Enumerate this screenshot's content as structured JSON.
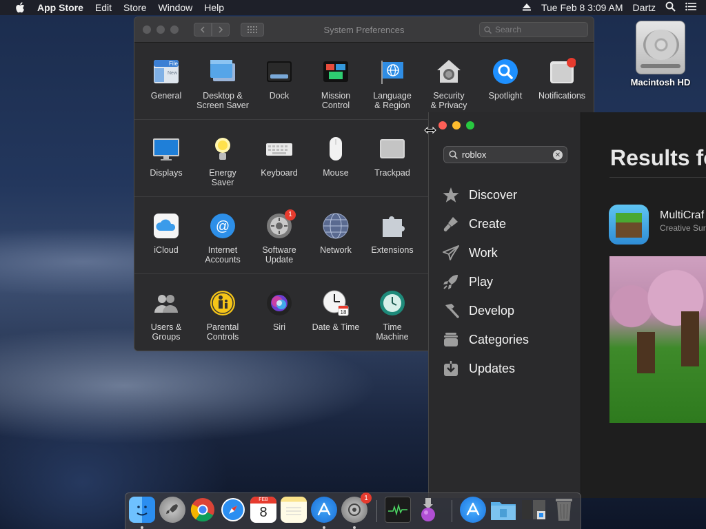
{
  "menubar": {
    "app_name": "App Store",
    "menus": [
      "Edit",
      "Store",
      "Window",
      "Help"
    ],
    "datetime": "Tue Feb 8  3:09 AM",
    "user": "Dartz"
  },
  "desktop": {
    "disk_label": "Macintosh HD"
  },
  "system_preferences": {
    "title": "System Preferences",
    "search_placeholder": "Search",
    "rows": [
      [
        {
          "label": "General",
          "icon": "general-icon"
        },
        {
          "label": "Desktop &\nScreen Saver",
          "icon": "desktop-screensaver-icon"
        },
        {
          "label": "Dock",
          "icon": "dock-icon"
        },
        {
          "label": "Mission\nControl",
          "icon": "mission-control-icon"
        },
        {
          "label": "Language\n& Region",
          "icon": "language-region-icon"
        },
        {
          "label": "Security\n& Privacy",
          "icon": "security-privacy-icon"
        },
        {
          "label": "Spotlight",
          "icon": "spotlight-icon"
        },
        {
          "label": "Notifications",
          "icon": "notifications-icon"
        }
      ],
      [
        {
          "label": "Displays",
          "icon": "displays-icon"
        },
        {
          "label": "Energy\nSaver",
          "icon": "energy-saver-icon"
        },
        {
          "label": "Keyboard",
          "icon": "keyboard-icon"
        },
        {
          "label": "Mouse",
          "icon": "mouse-icon"
        },
        {
          "label": "Trackpad",
          "icon": "trackpad-icon"
        }
      ],
      [
        {
          "label": "iCloud",
          "icon": "icloud-icon"
        },
        {
          "label": "Internet\nAccounts",
          "icon": "internet-accounts-icon"
        },
        {
          "label": "Software\nUpdate",
          "icon": "software-update-icon",
          "badge": "1"
        },
        {
          "label": "Network",
          "icon": "network-icon"
        },
        {
          "label": "Extensions",
          "icon": "extensions-icon"
        }
      ],
      [
        {
          "label": "Users &\nGroups",
          "icon": "users-groups-icon"
        },
        {
          "label": "Parental\nControls",
          "icon": "parental-controls-icon"
        },
        {
          "label": "Siri",
          "icon": "siri-icon"
        },
        {
          "label": "Date & Time",
          "icon": "date-time-icon"
        },
        {
          "label": "Time\nMachine",
          "icon": "time-machine-icon"
        }
      ]
    ]
  },
  "app_store": {
    "search_value": "roblox",
    "nav": [
      {
        "label": "Discover",
        "icon": "star-icon"
      },
      {
        "label": "Create",
        "icon": "brush-icon"
      },
      {
        "label": "Work",
        "icon": "paper-plane-icon"
      },
      {
        "label": "Play",
        "icon": "rocket-icon"
      },
      {
        "label": "Develop",
        "icon": "hammer-icon"
      },
      {
        "label": "Categories",
        "icon": "categories-icon"
      },
      {
        "label": "Updates",
        "icon": "updates-icon"
      }
    ],
    "results_heading": "Results fo",
    "result": {
      "name": "MultiCraf",
      "subtitle": "Creative Sur"
    }
  },
  "dock": {
    "apps": [
      "finder-icon",
      "launchpad-icon",
      "chrome-icon",
      "safari-icon",
      "calendar-icon",
      "notes-icon",
      "app-store-icon",
      "system-preferences-icon",
      "activity-monitor-icon",
      "installer-icon",
      "applications-folder-icon",
      "documents-folder-icon",
      "downloads-stack-icon",
      "trash-icon"
    ],
    "calendar_month": "FEB",
    "calendar_day": "8",
    "system_preferences_badge": "1"
  }
}
